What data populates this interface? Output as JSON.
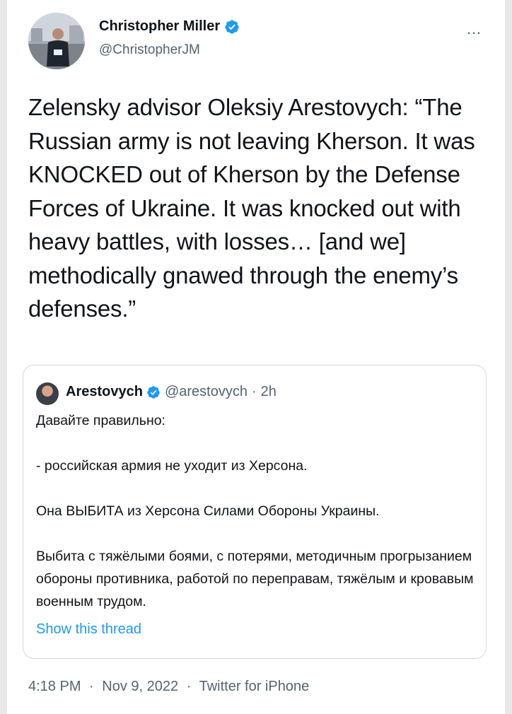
{
  "author": {
    "display_name": "Christopher Miller",
    "handle": "@ChristopherJM",
    "verified_icon": "verified-badge-icon",
    "avatar_icon": "profile-photo"
  },
  "more_icon": "…",
  "tweet": {
    "text": "Zelensky advisor Oleksiy Arestovych: “The Russian army is not leaving Kherson. It was KNOCKED out of Kherson by the Defense Forces of Ukraine. It was knocked out with heavy battles, with losses… [and we] methodically gnawed through the enemy’s defenses.”"
  },
  "quoted_tweet": {
    "display_name": "Arestovych",
    "handle": "@arestovych",
    "separator": "·",
    "time": "2h",
    "paragraphs": [
      "Давайте правильно:",
      "- российская армия не уходит из Херсона.",
      "Она ВЫБИТА из Херсона Силами Обороны Украины.",
      "Выбита с тяжёлыми боями, с потерями, методичным прогрызанием обороны противника, работой по переправам, тяжёлым и кровавым военным трудом."
    ],
    "show_thread": "Show this thread"
  },
  "footer": {
    "time": "4:18 PM",
    "date": "Nov 9, 2022",
    "source": "Twitter for iPhone",
    "separator": "·"
  },
  "colors": {
    "accent": "#1d9bf0",
    "text": "#0f1419",
    "muted": "#536471",
    "border": "#cfd9de"
  }
}
